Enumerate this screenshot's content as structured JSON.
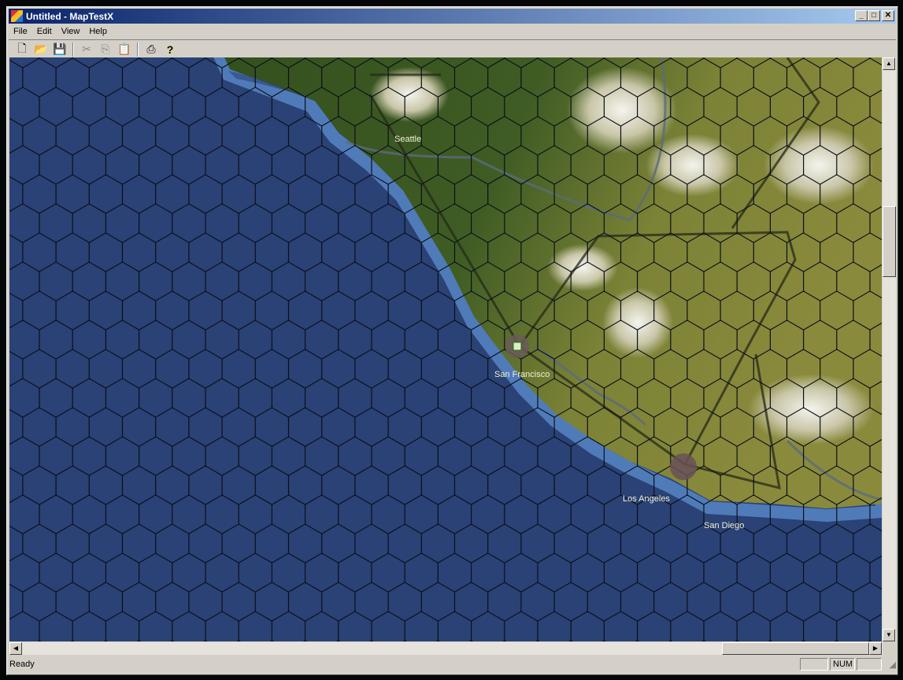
{
  "window": {
    "title": "Untitled - MapTestX",
    "minimize": "_",
    "maximize": "□",
    "close": "✕"
  },
  "menu": [
    "File",
    "Edit",
    "View",
    "Help"
  ],
  "toolbar": [
    {
      "icon": "new-file-icon",
      "glyph": "🗋",
      "enabled": true
    },
    {
      "icon": "open-folder-icon",
      "glyph": "📂",
      "enabled": true
    },
    {
      "icon": "save-icon",
      "glyph": "💾",
      "enabled": true
    },
    {
      "icon": "cut-icon",
      "glyph": "✂",
      "enabled": false
    },
    {
      "icon": "copy-icon",
      "glyph": "⎘",
      "enabled": false
    },
    {
      "icon": "paste-icon",
      "glyph": "📋",
      "enabled": false
    },
    {
      "icon": "print-icon",
      "glyph": "⎙",
      "enabled": true
    },
    {
      "icon": "help-icon",
      "glyph": "?",
      "enabled": true
    }
  ],
  "map": {
    "cities": [
      {
        "name": "Seattle",
        "has_marker": false
      },
      {
        "name": "San Francisco",
        "has_marker": true
      },
      {
        "name": "Los Angeles",
        "has_marker": true
      },
      {
        "name": "San Diego",
        "has_marker": false
      }
    ],
    "colors": {
      "ocean": "#2a4275",
      "coast": "#5d8fd0",
      "forest": "#3e5a22",
      "plains": "#8a8a3a",
      "hexline": "#0b0f1a"
    }
  },
  "scroll": {
    "up": "▲",
    "down": "▼",
    "left": "◀",
    "right": "▶"
  },
  "status": {
    "text": "Ready",
    "panes": [
      "",
      "NUM",
      ""
    ]
  }
}
